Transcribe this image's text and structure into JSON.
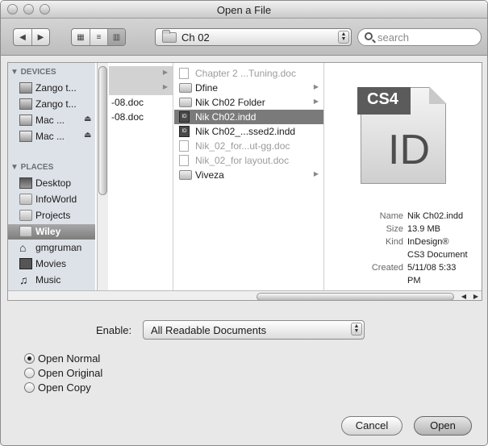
{
  "window": {
    "title": "Open a File"
  },
  "toolbar": {
    "nav_back": "◀",
    "nav_forward": "▶",
    "view_icon": "▦",
    "view_list": "≡",
    "view_columns": "▥",
    "location": "Ch 02",
    "search_placeholder": "search"
  },
  "sidebar": {
    "devices_header": "▼ DEVICES",
    "places_header": "▼ PLACES",
    "devices": [
      {
        "label": "Zango t...",
        "icon": "drive-icon"
      },
      {
        "label": "Zango t...",
        "icon": "drive-icon"
      },
      {
        "label": "Mac ...",
        "icon": "drive-icon",
        "eject": "⏏"
      },
      {
        "label": "Mac ...",
        "icon": "drive-icon",
        "eject": "⏏"
      }
    ],
    "places": [
      {
        "label": "Desktop",
        "icon": "desktop-icon"
      },
      {
        "label": "InfoWorld",
        "icon": "folder-icon"
      },
      {
        "label": "Projects",
        "icon": "folder-icon"
      },
      {
        "label": "Wiley",
        "icon": "folder-icon",
        "selected": true
      },
      {
        "label": "gmgruman",
        "icon": "home-icon"
      },
      {
        "label": "Movies",
        "icon": "movies-icon"
      },
      {
        "label": "Music",
        "icon": "music-icon"
      }
    ]
  },
  "column1": {
    "rows": [
      {
        "label": "",
        "arrow": "▶"
      },
      {
        "label": "",
        "arrow": "▶"
      },
      {
        "label": "-08.doc"
      },
      {
        "label": "-08.doc"
      }
    ]
  },
  "column2": {
    "rows": [
      {
        "label": "Chapter 2 ...Tuning.doc",
        "icon": "doc",
        "dim": true
      },
      {
        "label": "Dfine",
        "icon": "folder",
        "arrow": "▶"
      },
      {
        "label": "Nik Ch02 Folder",
        "icon": "folder",
        "arrow": "▶"
      },
      {
        "label": "Nik Ch02.indd",
        "icon": "indd",
        "selected": true
      },
      {
        "label": "Nik Ch02_...ssed2.indd",
        "icon": "indd"
      },
      {
        "label": "Nik_02_for...ut-gg.doc",
        "icon": "doc",
        "dim": true
      },
      {
        "label": "Nik_02_for layout.doc",
        "icon": "doc",
        "dim": true
      },
      {
        "label": "Viveza",
        "icon": "folder",
        "arrow": "▶"
      }
    ]
  },
  "preview": {
    "icon_badge": "CS4",
    "icon_glyph": "ID",
    "name_key": "Name",
    "name_val": "Nik Ch02.indd",
    "size_key": "Size",
    "size_val": "13.9 MB",
    "kind_key": "Kind",
    "kind_val1": "InDesign®",
    "kind_val2": "CS3 Document",
    "created_key": "Created",
    "created_val1": "5/11/08 5:33",
    "created_val2": "PM"
  },
  "options": {
    "enable_label": "Enable:",
    "enable_value": "All Readable Documents",
    "radios": [
      {
        "label": "Open Normal",
        "checked": true
      },
      {
        "label": "Open Original",
        "checked": false
      },
      {
        "label": "Open Copy",
        "checked": false
      }
    ],
    "cancel": "Cancel",
    "open": "Open"
  }
}
